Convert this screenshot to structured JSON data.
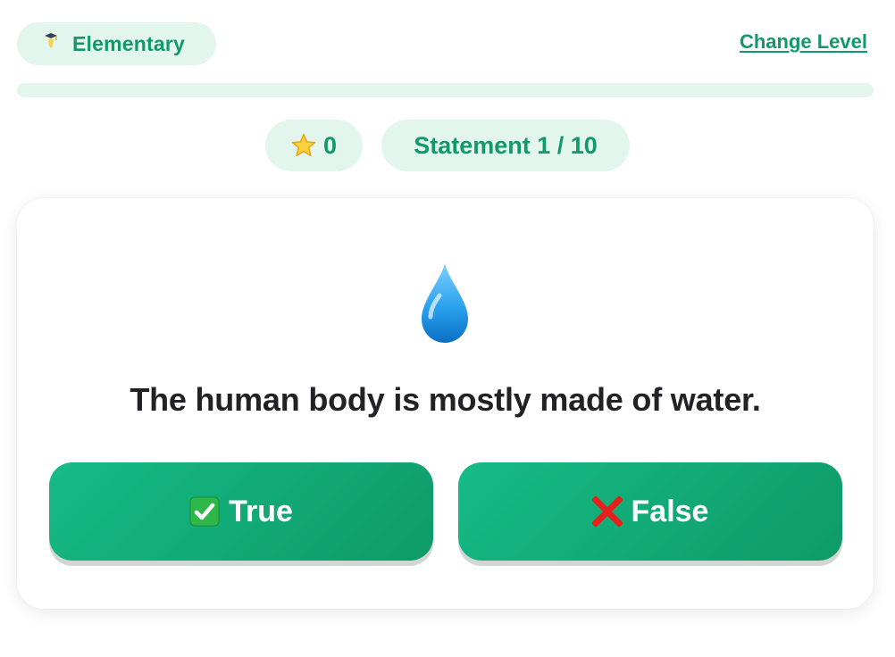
{
  "header": {
    "level_label": "Elementary",
    "level_icon": "graduation-cap-icon",
    "change_level_label": "Change Level"
  },
  "progress": {
    "fraction": 0.0
  },
  "stats": {
    "score": "0",
    "score_icon": "star-icon",
    "statement_counter": "Statement 1 / 10"
  },
  "question": {
    "icon": "water-drop-icon",
    "text": "The human body is mostly made of water."
  },
  "answers": {
    "true_label": "True",
    "true_icon": "check-mark-icon",
    "false_label": "False",
    "false_icon": "cross-mark-icon"
  },
  "colors": {
    "accent": "#12996a",
    "pill_bg": "#e3f6ee",
    "button_bg": "#12ae79",
    "text_dark": "#222226"
  }
}
